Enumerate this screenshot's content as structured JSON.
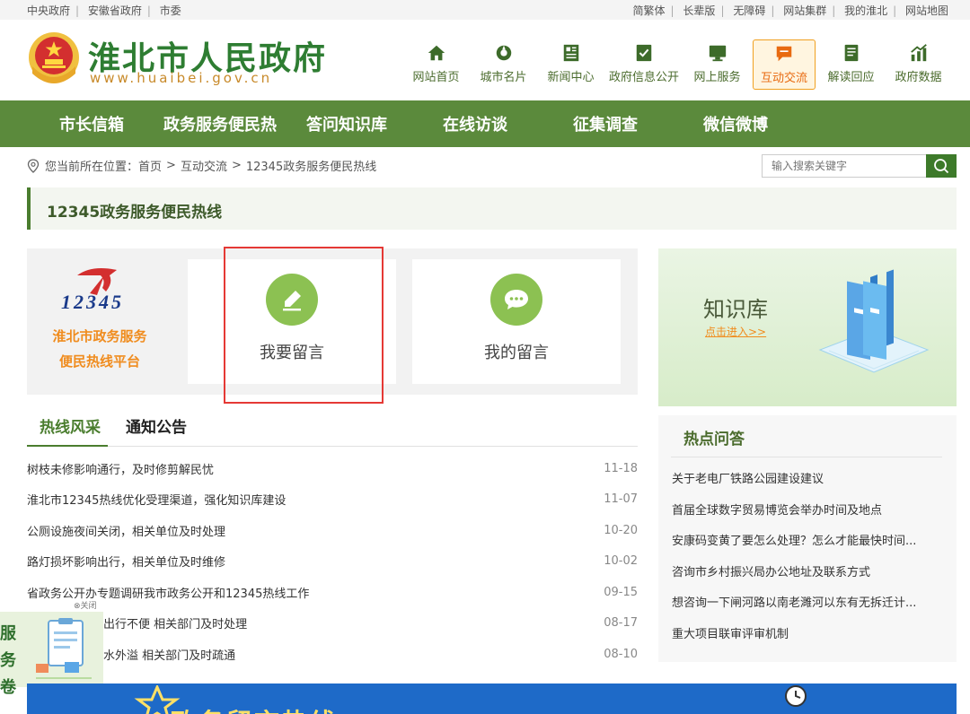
{
  "topbar": {
    "left_links": [
      "中央政府",
      "安徽省政府",
      "市委"
    ],
    "right_links": [
      "简繁体",
      "长辈版",
      "无障碍",
      "网站集群",
      "我的淮北",
      "网站地图"
    ]
  },
  "header": {
    "title": "淮北市人民政府",
    "domain": "www.huaibei.gov.cn",
    "nav_icons": [
      {
        "label": "网站首页",
        "icon": "home-icon"
      },
      {
        "label": "城市名片",
        "icon": "city-card-icon"
      },
      {
        "label": "新闻中心",
        "icon": "news-icon"
      },
      {
        "label": "政府信息公开",
        "icon": "info-disclosure-icon"
      },
      {
        "label": "网上服务",
        "icon": "online-service-icon"
      },
      {
        "label": "互动交流",
        "icon": "chat-icon",
        "active": true
      },
      {
        "label": "解读回应",
        "icon": "book-icon"
      },
      {
        "label": "政府数据",
        "icon": "data-chart-icon"
      }
    ]
  },
  "main_nav": [
    "市长信箱",
    "政务服务便民热",
    "答问知识库",
    "在线访谈",
    "征集调查",
    "微信微博"
  ],
  "breadcrumb": {
    "prefix": "您当前所在位置：",
    "items": [
      "首页",
      "互动交流",
      "12345政务服务便民热线"
    ]
  },
  "search": {
    "placeholder": "输入搜索关键字"
  },
  "section_title": "12345政务服务便民热线",
  "hotline": {
    "logo_number": "12345",
    "platform_line1": "淮北市政务服务",
    "platform_line2": "便民热线平台",
    "leave_message": "我要留言",
    "my_messages": "我的留言"
  },
  "tabs": [
    "热线风采",
    "通知公告"
  ],
  "news": [
    {
      "title": "树枝未修影响通行，及时修剪解民忧",
      "date": "11-18"
    },
    {
      "title": "淮北市12345热线优化受理渠道，强化知识库建设",
      "date": "11-07"
    },
    {
      "title": "公厕设施夜间关闭，相关单位及时处理",
      "date": "10-20"
    },
    {
      "title": "路灯损坏影响出行，相关单位及时维修",
      "date": "10-02"
    },
    {
      "title": "省政务公开办专题调研我市政务公开和12345热线工作",
      "date": "09-15"
    },
    {
      "title": "出行不便 相关部门及时处理",
      "date": "08-17"
    },
    {
      "title": "水外溢 相关部门及时疏通",
      "date": "08-10"
    }
  ],
  "knowledge": {
    "title": "知识库",
    "link": "点击进入>>"
  },
  "hot_qa": {
    "title": "热点问答",
    "items": [
      "关于老电厂铁路公园建设建议",
      "首届全球数字贸易博览会举办时间及地点",
      "安康码变黄了要怎么处理？怎么才能最快时间...",
      "咨询市乡村振兴局办公地址及联系方式",
      "想咨询一下闸河路以南老濉河以东有无拆迁计...",
      "重大项目联审评审机制"
    ]
  },
  "float_survey": {
    "close_label": "⊗关闭",
    "text_line1": "服务",
    "text_line2": "卷"
  },
  "banner": {
    "text": "政务留言热线"
  }
}
